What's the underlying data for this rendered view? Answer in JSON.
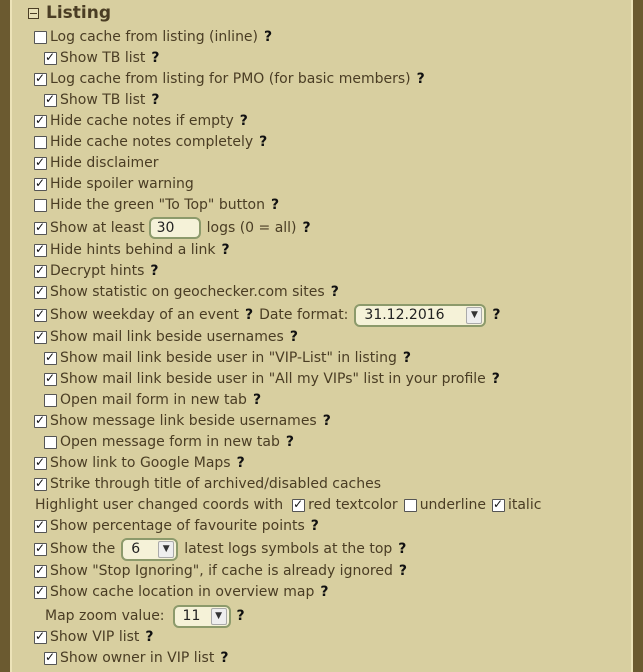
{
  "section_title": "Listing",
  "help": "?",
  "rows": [
    {
      "label": "Log cache from listing (inline)",
      "checked": false
    },
    {
      "label": "Show TB list",
      "checked": true
    },
    {
      "label": "Log cache from listing for PMO (for basic members)",
      "checked": true
    },
    {
      "label": "Show TB list",
      "checked": true
    },
    {
      "label": "Hide cache notes if empty",
      "checked": true
    },
    {
      "label": "Hide cache notes completely",
      "checked": false
    },
    {
      "label": "Hide disclaimer",
      "checked": true
    },
    {
      "label": "Hide spoiler warning",
      "checked": true
    },
    {
      "label": "Hide the green \"To Top\" button",
      "checked": false
    },
    {
      "label_before": "Show at least",
      "value": "30",
      "label_after": "logs (0 = all)",
      "checked": true
    },
    {
      "label": "Hide hints behind a link",
      "checked": true
    },
    {
      "label": "Decrypt hints",
      "checked": true
    },
    {
      "label": "Show statistic on geochecker.com sites",
      "checked": true
    },
    {
      "label": "Show weekday of an event",
      "label2": "Date format:",
      "select": "31.12.2016",
      "checked": true
    },
    {
      "label": "Show mail link beside usernames",
      "checked": true
    },
    {
      "label": "Show mail link beside user in \"VIP-List\" in listing",
      "checked": true
    },
    {
      "label": "Show mail link beside user in \"All my VIPs\" list in your profile",
      "checked": true
    },
    {
      "label": "Open mail form in new tab",
      "checked": false
    },
    {
      "label": "Show message link beside usernames",
      "checked": true
    },
    {
      "label": "Open message form in new tab",
      "checked": false
    },
    {
      "label": "Show link to Google Maps",
      "checked": true
    },
    {
      "label": "Strike through title of archived/disabled caches",
      "checked": true
    },
    {
      "label": "Highlight user changed coords with",
      "options": [
        {
          "label": "red textcolor",
          "checked": true
        },
        {
          "label": "underline",
          "checked": false
        },
        {
          "label": "italic",
          "checked": true
        }
      ]
    },
    {
      "label": "Show percentage of favourite points",
      "checked": true
    },
    {
      "label_before": "Show the",
      "select": "6",
      "label_after": "latest logs symbols at the top",
      "checked": true
    },
    {
      "label": "Show \"Stop Ignoring\", if cache is already ignored",
      "checked": true
    },
    {
      "label": "Show cache location in overview map",
      "checked": true
    },
    {
      "label": "Map zoom value:",
      "select": "11"
    },
    {
      "label": "Show VIP list",
      "checked": true
    },
    {
      "label": "Show owner in VIP list",
      "checked": true
    }
  ]
}
